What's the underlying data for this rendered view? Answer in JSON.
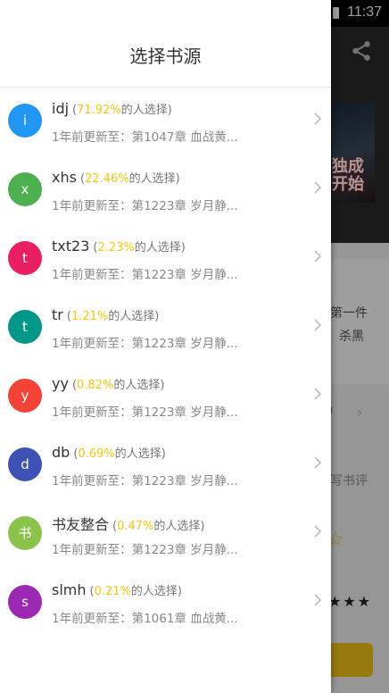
{
  "status": {
    "time": "11:37"
  },
  "background": {
    "cover_text": "独成开始",
    "desc_line1": "第一件",
    "desc_line2": "杀黑",
    "paren": ")",
    "review_label": "写书评",
    "stars": "★★★"
  },
  "drawer": {
    "title": "选择书源",
    "sources": [
      {
        "initial": "i",
        "name": "idj",
        "percent": "71.92%",
        "suffix": "的人选择)",
        "update": "1年前更新至：第1047章 血战黄...",
        "color": "#2196f3"
      },
      {
        "initial": "x",
        "name": "xhs",
        "percent": "22.46%",
        "suffix": "的人选择)",
        "update": "1年前更新至：第1223章 岁月静...",
        "color": "#4caf50"
      },
      {
        "initial": "t",
        "name": "txt23",
        "percent": "2.23%",
        "suffix": "的人选择)",
        "update": "1年前更新至：第1223章 岁月静...",
        "color": "#e91e63"
      },
      {
        "initial": "t",
        "name": "tr",
        "percent": "1.21%",
        "suffix": "的人选择)",
        "update": "1年前更新至：第1223章 岁月静...",
        "color": "#009688"
      },
      {
        "initial": "y",
        "name": "yy",
        "percent": "0.82%",
        "suffix": "的人选择)",
        "update": "1年前更新至：第1223章 岁月静...",
        "color": "#f44336"
      },
      {
        "initial": "d",
        "name": "db",
        "percent": "0.69%",
        "suffix": "的人选择)",
        "update": "1年前更新至：第1223章 岁月静...",
        "color": "#3f51b5"
      },
      {
        "initial": "书",
        "name": "书友整合",
        "percent": "0.47%",
        "suffix": "的人选择)",
        "update": "1年前更新至：第1223章 岁月静...",
        "color": "#8bc34a"
      },
      {
        "initial": "s",
        "name": "slmh",
        "percent": "0.21%",
        "suffix": "的人选择)",
        "update": "1年前更新至：第1061章 血战黄...",
        "color": "#9c27b0"
      }
    ]
  }
}
